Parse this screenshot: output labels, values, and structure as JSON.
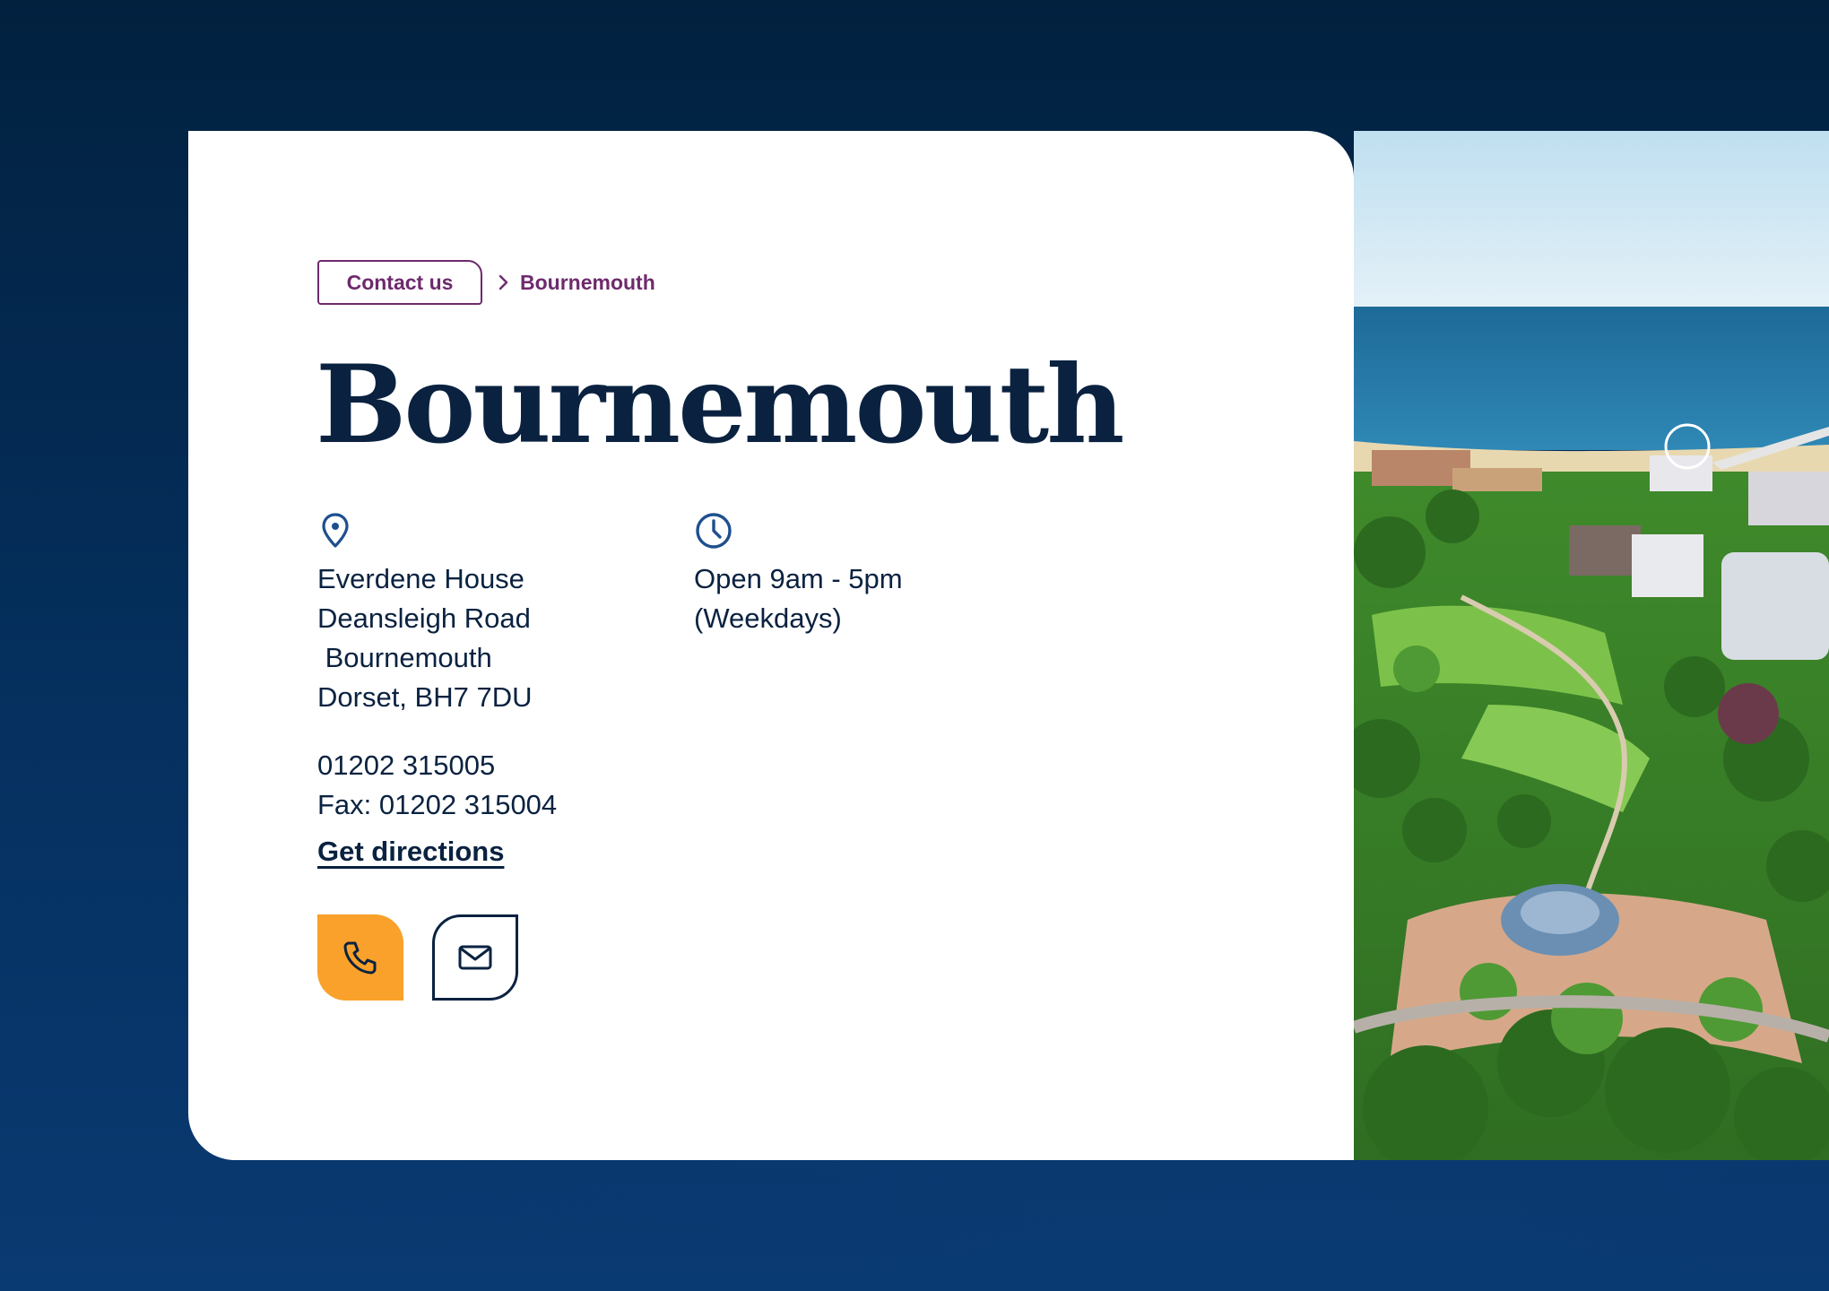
{
  "breadcrumb": {
    "parent_label": "Contact us",
    "current_label": "Bournemouth"
  },
  "page_title": "Bournemouth",
  "address": {
    "lines": [
      "Everdene House",
      "Deansleigh Road",
      " Bournemouth",
      "Dorset, BH7 7DU"
    ]
  },
  "hours": {
    "lines": [
      "Open 9am - 5pm",
      "(Weekdays)"
    ]
  },
  "contact": {
    "phone": "01202 315005",
    "fax": "Fax: 01202 315004",
    "directions_label": "Get directions"
  },
  "icons": {
    "address": "map-pin-icon",
    "hours": "clock-icon",
    "phone_button": "phone-icon",
    "email_button": "envelope-icon",
    "breadcrumb_separator": "chevron-right-icon"
  },
  "colors": {
    "background": "#02213f",
    "card": "#ffffff",
    "primary_text": "#0a2240",
    "breadcrumb": "#6e2a6d",
    "icon_blue": "#1f4f8f",
    "phone_button": "#f9a12a"
  }
}
